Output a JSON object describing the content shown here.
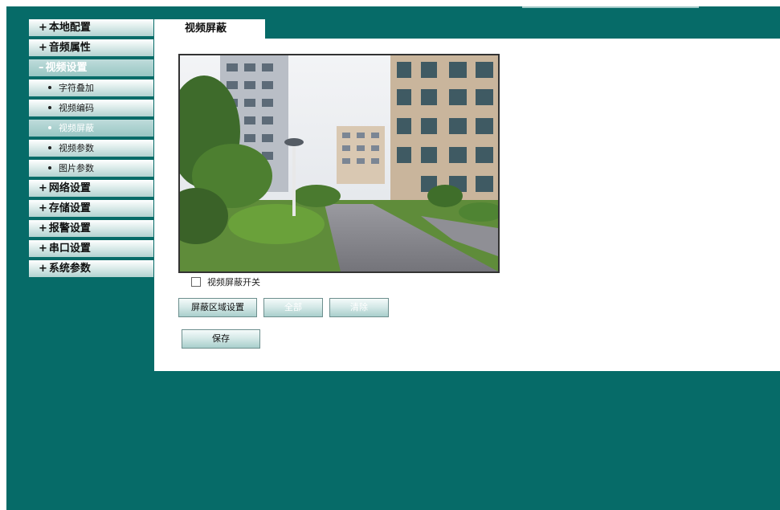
{
  "sidebar": {
    "items": [
      {
        "prefix": "+",
        "label": "本地配置"
      },
      {
        "prefix": "+",
        "label": "音频属性"
      },
      {
        "prefix": "–",
        "label": "视频设置"
      },
      {
        "prefix": "+",
        "label": "网络设置"
      },
      {
        "prefix": "+",
        "label": "存储设置"
      },
      {
        "prefix": "+",
        "label": "报警设置"
      },
      {
        "prefix": "+",
        "label": "串口设置"
      },
      {
        "prefix": "+",
        "label": "系统参数"
      }
    ],
    "video_subitems": [
      {
        "label": "字符叠加"
      },
      {
        "label": "视频编码"
      },
      {
        "label": "视频屏蔽"
      },
      {
        "label": "视频参数"
      },
      {
        "label": "图片参数"
      }
    ]
  },
  "tab": {
    "label": "视频屏蔽"
  },
  "main": {
    "checkbox_label": "视频屏蔽开关",
    "checkbox_checked": false,
    "buttons": {
      "mask_area": "屏蔽区域设置",
      "all": "全部",
      "clear": "清除",
      "save": "保存"
    }
  },
  "colors": {
    "background": "#066b68",
    "menu_active_text": "#ffffff"
  }
}
